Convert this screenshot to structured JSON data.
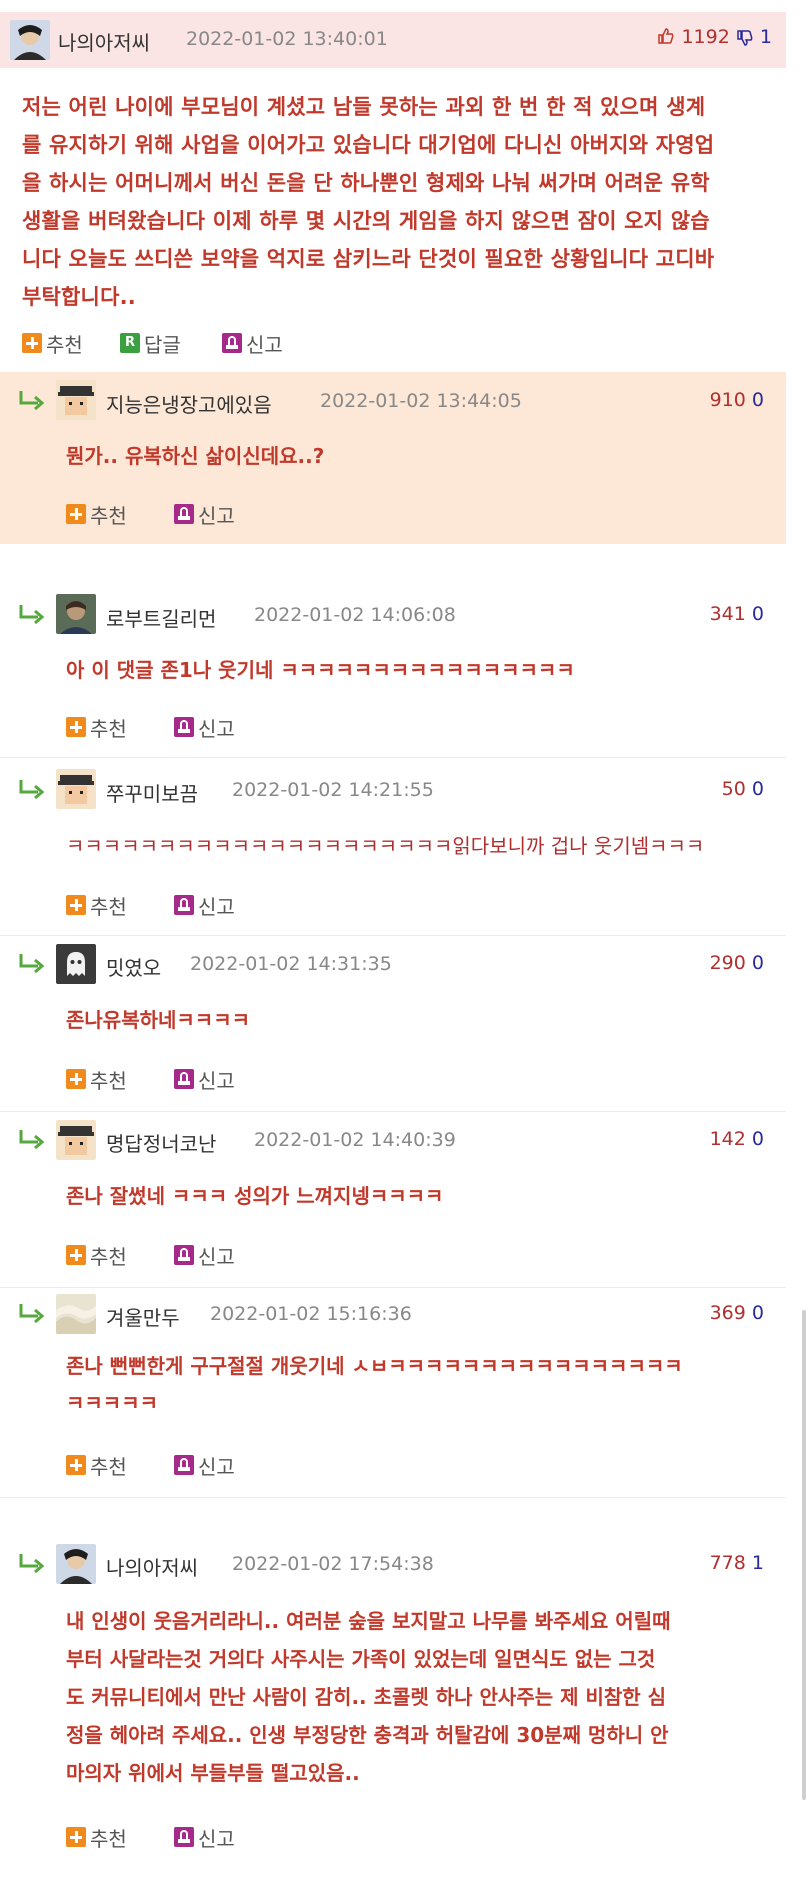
{
  "post": {
    "author": "나의아저씨",
    "time": "2022-01-02 13:40:01",
    "likes": "1192",
    "dislikes": "1",
    "lines": [
      "저는 어린 나이에 부모님이 계셨고 남들 못하는 과외 한 번 한 적 있으며 생계",
      "를 유지하기 위해 사업을 이어가고 있습니다 대기업에 다니신 아버지와 자영업",
      "을 하시는 어머니께서 버신 돈을 단 하나뿐인 형제와 나눠 써가며 어려운 유학",
      "생활을 버텨왔습니다 이제 하루 몇 시간의 게임을 하지 않으면 잠이 오지 않습",
      "니다 오늘도 쓰디쓴 보약을 억지로 삼키느라 단것이 필요한 상황입니다 고디바",
      "부탁합니다.."
    ],
    "actions": {
      "recommend": "추천",
      "reply": "답글",
      "report": "신고"
    }
  },
  "labels": {
    "recommend": "추천",
    "report": "신고"
  },
  "comments": [
    {
      "author": "지능은냉장고에있음",
      "time": "2022-01-02 13:44:05",
      "up": "910",
      "down": "0",
      "lines": [
        "뭔가.. 유복하신 삶이신데요..?"
      ]
    },
    {
      "author": "로부트길리먼",
      "time": "2022-01-02 14:06:08",
      "up": "341",
      "down": "0",
      "lines": [
        "아 이 댓글 존1나 웃기네 ㅋㅋㅋㅋㅋㅋㅋㅋㅋㅋㅋㅋㅋㅋㅋㅋ"
      ]
    },
    {
      "author": "쭈꾸미보끔",
      "time": "2022-01-02 14:21:55",
      "up": "50",
      "down": "0",
      "lines": [
        "ㅋㅋㅋㅋㅋㅋㅋㅋㅋㅋㅋㅋㅋㅋㅋㅋㅋㅋㅋㅋㅋ읽다보니까 겁나 웃기넴ㅋㅋㅋ"
      ]
    },
    {
      "author": "밋였오",
      "time": "2022-01-02 14:31:35",
      "up": "290",
      "down": "0",
      "lines": [
        "존나유복하네ㅋㅋㅋㅋ"
      ]
    },
    {
      "author": "명답정너코난",
      "time": "2022-01-02 14:40:39",
      "up": "142",
      "down": "0",
      "lines": [
        "존나 잘썼네 ㅋㅋㅋ 성의가 느껴지넹ㅋㅋㅋㅋ"
      ]
    },
    {
      "author": "겨울만두",
      "time": "2022-01-02 15:16:36",
      "up": "369",
      "down": "0",
      "lines": [
        "존나 뻔뻔한게 구구절절 개웃기네 ㅅㅂㅋㅋㅋㅋㅋㅋㅋㅋㅋㅋㅋㅋㅋㅋㅋㅋ",
        "ㅋㅋㅋㅋㅋ"
      ]
    },
    {
      "author": "나의아저씨",
      "time": "2022-01-02 17:54:38",
      "up": "778",
      "down": "1",
      "lines": [
        "내 인생이 웃음거리라니.. 여러분 숲을 보지말고 나무를 봐주세요 어릴때",
        "부터 사달라는것 거의다 사주시는 가족이 있었는데 일면식도 없는 그것",
        "도 커뮤니티에서 만난 사람이 감히.. 초콜렛 하나 안사주는 제 비참한 심",
        "정을 헤아려 주세요.. 인생 부정당한 충격과 허탈감에 30분째 멍하니 안",
        "마의자 위에서 부들부들 떨고있음.."
      ]
    }
  ]
}
